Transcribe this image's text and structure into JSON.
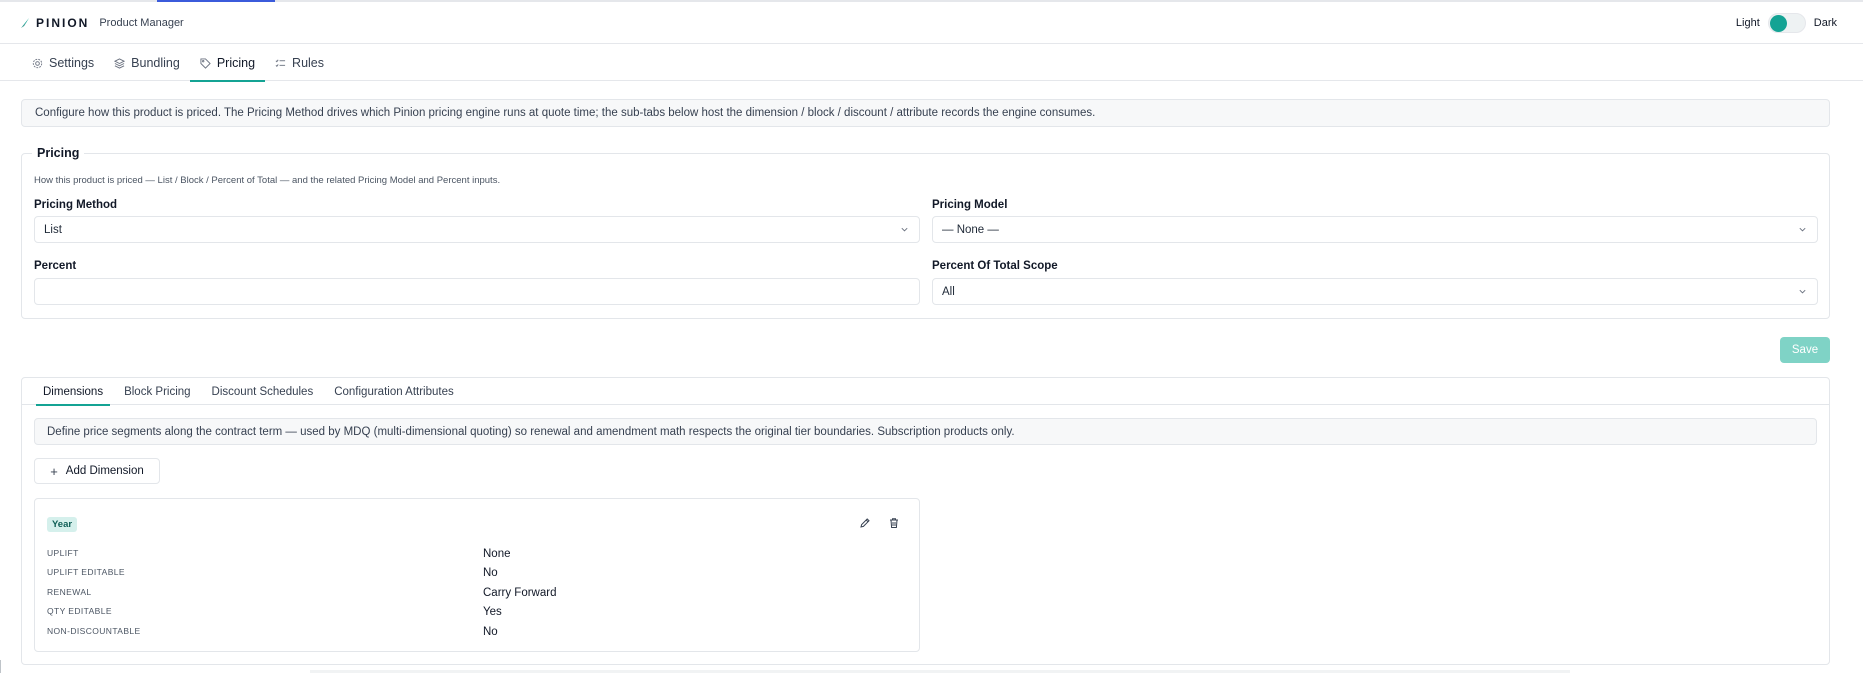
{
  "header": {
    "brand_name": "PINION",
    "brand_sub": "Product Manager",
    "theme_light": "Light",
    "theme_dark": "Dark"
  },
  "main_tabs": [
    {
      "label": "Settings",
      "icon": "gear-icon"
    },
    {
      "label": "Bundling",
      "icon": "layers-icon"
    },
    {
      "label": "Pricing",
      "icon": "tag-icon",
      "active": true
    },
    {
      "label": "Rules",
      "icon": "rules-icon"
    }
  ],
  "info_banner": "Configure how this product is priced. The Pricing Method drives which Pinion pricing engine runs at quote time; the sub-tabs below host the dimension / block / discount / attribute records the engine consumes.",
  "pricing": {
    "legend": "Pricing",
    "description": "How this product is priced — List / Block / Percent of Total — and the related Pricing Model and Percent inputs.",
    "pricing_method_label": "Pricing Method",
    "pricing_method_value": "List",
    "pricing_model_label": "Pricing Model",
    "pricing_model_value": "— None —",
    "percent_label": "Percent",
    "percent_value": "",
    "percent_scope_label": "Percent Of Total Scope",
    "percent_scope_value": "All"
  },
  "save_label": "Save",
  "sub_tabs": [
    {
      "label": "Dimensions",
      "active": true
    },
    {
      "label": "Block Pricing"
    },
    {
      "label": "Discount Schedules"
    },
    {
      "label": "Configuration Attributes"
    }
  ],
  "dimensions": {
    "banner": "Define price segments along the contract term — used by MDQ (multi-dimensional quoting) so renewal and amendment math respects the original tier boundaries. Subscription products only.",
    "add_label": "Add Dimension",
    "card": {
      "badge": "Year",
      "rows": [
        {
          "label": "UPLIFT",
          "value": "None"
        },
        {
          "label": "UPLIFT EDITABLE",
          "value": "No"
        },
        {
          "label": "RENEWAL",
          "value": "Carry Forward"
        },
        {
          "label": "QTY EDITABLE",
          "value": "Yes"
        },
        {
          "label": "NON-DISCOUNTABLE",
          "value": "No"
        }
      ]
    }
  },
  "colors": {
    "accent": "#14a394",
    "save_disabled": "#7fd3c6",
    "badge_bg": "#d5f0ec"
  }
}
